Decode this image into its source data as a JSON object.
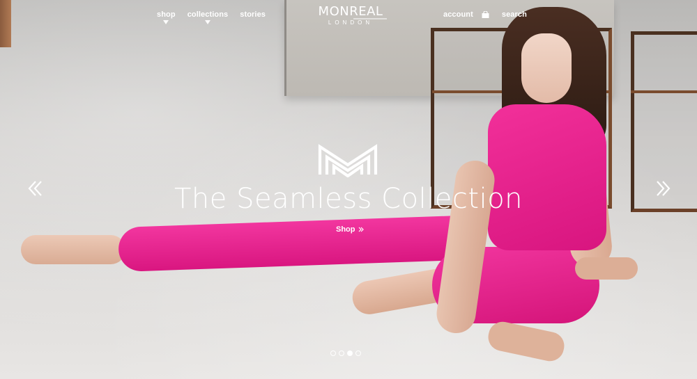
{
  "header": {
    "nav_left": [
      {
        "label": "shop",
        "has_dropdown": true
      },
      {
        "label": "collections",
        "has_dropdown": true
      },
      {
        "label": "stories",
        "has_dropdown": false
      }
    ],
    "logo": {
      "main": "MONREAL",
      "sub": "LONDON"
    },
    "nav_right": {
      "account": "account",
      "bag_icon": "shopping-bag-icon",
      "search": "search"
    }
  },
  "hero": {
    "headline": "The Seamless Collection",
    "cta": "Shop",
    "prev_icon": "double-chevron-left-icon",
    "next_icon": "double-chevron-right-icon",
    "slides_total": 4,
    "active_slide": 3
  },
  "colors": {
    "text": "#ffffff",
    "accent_pink": "#e81f8d"
  }
}
